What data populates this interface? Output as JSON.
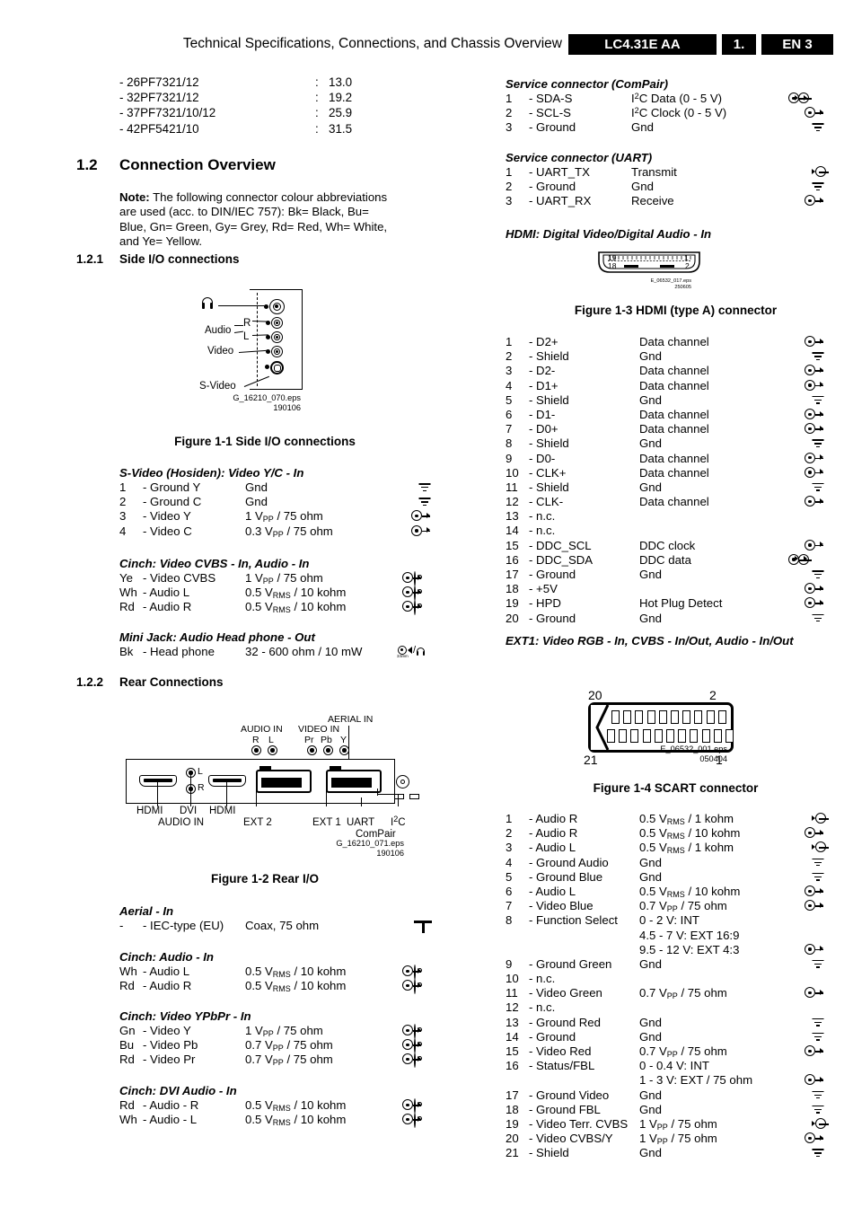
{
  "header": {
    "title": "Technical Specifications, Connections, and Chassis Overview",
    "chassis": "LC4.31E AA",
    "section": "1.",
    "page": "EN 3"
  },
  "models": [
    {
      "name": "- 26PF7321/12",
      "colon": ":",
      "value": "13.0"
    },
    {
      "name": "- 32PF7321/12",
      "colon": ":",
      "value": "19.2"
    },
    {
      "name": "- 37PF7321/10/12",
      "colon": ":",
      "value": "25.9"
    },
    {
      "name": "- 42PF5421/10",
      "colon": ":",
      "value": "31.5"
    }
  ],
  "section_12": {
    "number": "1.2",
    "title": "Connection Overview",
    "note_label": "Note:",
    "note_text": " The following connector colour abbreviations are used (acc. to DIN/IEC 757): Bk= Black, Bu= Blue, Gn= Green, Gy= Grey, Rd= Red, Wh= White, and Ye= Yellow."
  },
  "section_121": {
    "number": "1.2.1",
    "title": "Side I/O connections"
  },
  "section_122": {
    "number": "1.2.2",
    "title": "Rear Connections"
  },
  "figure_side_io": {
    "caption": "Figure 1-1 Side I/O connections",
    "eps": "G_16210_070.eps",
    "date": "190106",
    "labels": {
      "headphone": "headphone-icon",
      "audio": "Audio",
      "r": "R",
      "l": "L",
      "video": "Video",
      "svideo": "S-Video"
    }
  },
  "figure_rear_io": {
    "caption": "Figure 1-2 Rear I/O",
    "eps": "G_16210_071.eps",
    "date": "190106",
    "labels": {
      "audio_in": "AUDIO IN",
      "audio_r": "R",
      "audio_l": "L",
      "video_in": "VIDEO IN",
      "video_pr": "Pr",
      "video_pb": "Pb",
      "video_y": "Y",
      "aerial_in": "AERIAL IN",
      "hdmi1": "HDMI",
      "dvi": "DVI",
      "hdmi2": "HDMI",
      "dvi_audio_in": "AUDIO IN",
      "dvi_l": "L",
      "dvi_r": "R",
      "ext2": "EXT 2",
      "ext1": "EXT 1",
      "uart": "UART",
      "i2c_i": "I",
      "i2c_sup": "2",
      "i2c_c": "C",
      "compair": "ComPair"
    }
  },
  "figure_hdmi": {
    "caption": "Figure 1-3 HDMI (type A) connector",
    "eps": "E_06532_017.eps",
    "date": "250605",
    "pin_labels": {
      "p19": "19",
      "p18": "18",
      "p1": "1",
      "p2": "2"
    }
  },
  "figure_scart": {
    "caption": "Figure 1-4 SCART connector",
    "eps": "E_06532_001.eps",
    "date": "050404",
    "pin_labels": {
      "p20": "20",
      "p2": "2",
      "p21": "21",
      "p1": "1"
    }
  },
  "groups": {
    "svideo": {
      "title": "S-Video (Hosiden): Video Y/C - In",
      "rows": [
        {
          "pin": "1",
          "name": "- Ground Y",
          "value": "Gnd",
          "icon": "ground-icon"
        },
        {
          "pin": "2",
          "name": "- Ground C",
          "value": "Gnd",
          "icon": "ground-icon"
        },
        {
          "pin": "3",
          "name": "- Video Y",
          "value": "1 VPP / 75 ohm",
          "value_num": "1 V",
          "value_sub": "PP",
          "value_rest": " / 75 ohm",
          "icon": "input-icon"
        },
        {
          "pin": "4",
          "name": "- Video C",
          "value": "0.3 VPP / 75 ohm",
          "value_num": "0.3 V",
          "value_sub": "PP",
          "value_rest": " / 75 ohm",
          "icon": "input-icon"
        }
      ]
    },
    "cinch_cvbs": {
      "title": "Cinch: Video CVBS - In, Audio - In",
      "rows": [
        {
          "pin": "Ye",
          "name": "- Video CVBS",
          "value_num": "1 V",
          "value_sub": "PP",
          "value_rest": " / 75 ohm",
          "icon": "input-cinch-icon"
        },
        {
          "pin": "Wh",
          "name": "- Audio L",
          "value_num": "0.5 V",
          "value_sub": "RMS",
          "value_rest": " / 10 kohm",
          "icon": "input-cinch-icon"
        },
        {
          "pin": "Rd",
          "name": "- Audio R",
          "value_num": "0.5 V",
          "value_sub": "RMS",
          "value_rest": " / 10 kohm",
          "icon": "input-cinch-icon"
        }
      ]
    },
    "minijack": {
      "title": "Mini Jack: Audio Head phone - Out",
      "rows": [
        {
          "pin": "Bk",
          "name": "- Head phone",
          "value_num": "32 - 600 ohm / 10 mW",
          "value_sub": "",
          "value_rest": "",
          "icon": "headphone-jack-icon"
        }
      ]
    },
    "aerial": {
      "title": "Aerial - In",
      "rows": [
        {
          "pin": "-",
          "name": "- IEC-type (EU)",
          "value_num": "Coax, 75 ohm",
          "value_sub": "",
          "value_rest": "",
          "icon": "aerial-icon"
        }
      ]
    },
    "cinch_audio": {
      "title": "Cinch: Audio - In",
      "rows": [
        {
          "pin": "Wh",
          "name": "- Audio L",
          "value_num": "0.5 V",
          "value_sub": "RMS",
          "value_rest": " / 10 kohm",
          "icon": "input-cinch-icon"
        },
        {
          "pin": "Rd",
          "name": "- Audio R",
          "value_num": "0.5 V",
          "value_sub": "RMS",
          "value_rest": " / 10 kohm",
          "icon": "input-cinch-icon"
        }
      ]
    },
    "cinch_ypbpr": {
      "title": "Cinch: Video YPbPr - In",
      "rows": [
        {
          "pin": "Gn",
          "name": "- Video Y",
          "value_num": "1 V",
          "value_sub": "PP",
          "value_rest": " / 75 ohm",
          "icon": "input-cinch-icon"
        },
        {
          "pin": "Bu",
          "name": "- Video Pb",
          "value_num": "0.7 V",
          "value_sub": "PP",
          "value_rest": " / 75 ohm",
          "icon": "input-cinch-icon"
        },
        {
          "pin": "Rd",
          "name": "- Video Pr",
          "value_num": "0.7 V",
          "value_sub": "PP",
          "value_rest": " / 75 ohm",
          "icon": "input-cinch-icon"
        }
      ]
    },
    "cinch_dvi_audio": {
      "title": "Cinch: DVI Audio - In",
      "rows": [
        {
          "pin": "Rd",
          "name": "- Audio - R",
          "value_num": "0.5 V",
          "value_sub": "RMS",
          "value_rest": " / 10 kohm",
          "icon": "input-cinch-icon"
        },
        {
          "pin": "Wh",
          "name": "- Audio - L",
          "value_num": "0.5 V",
          "value_sub": "RMS",
          "value_rest": " / 10 kohm",
          "icon": "input-cinch-icon"
        }
      ]
    },
    "compair": {
      "title": "Service connector (ComPair)",
      "rows": [
        {
          "pin": "1",
          "name": "- SDA-S",
          "value_pre": "I",
          "value_sup": "2",
          "value_rest": "C Data (0 - 5 V)",
          "icon": "input-output-icon"
        },
        {
          "pin": "2",
          "name": "- SCL-S",
          "value_pre": "I",
          "value_sup": "2",
          "value_rest": "C Clock (0 - 5 V)",
          "icon": "input-icon"
        },
        {
          "pin": "3",
          "name": "- Ground",
          "value_pre": "Gnd",
          "value_sup": "",
          "value_rest": "",
          "icon": "ground-icon"
        }
      ]
    },
    "uart": {
      "title": "Service connector (UART)",
      "rows": [
        {
          "pin": "1",
          "name": "- UART_TX",
          "value_pre": "Transmit",
          "value_sup": "",
          "value_rest": "",
          "icon": "output-icon"
        },
        {
          "pin": "2",
          "name": "- Ground",
          "value_pre": "Gnd",
          "value_sup": "",
          "value_rest": "",
          "icon": "ground-icon"
        },
        {
          "pin": "3",
          "name": "- UART_RX",
          "value_pre": "Receive",
          "value_sup": "",
          "value_rest": "",
          "icon": "input-icon"
        }
      ]
    },
    "hdmi": {
      "title": "HDMI: Digital Video/Digital Audio - In",
      "rows": [
        {
          "pin": "1",
          "name": "- D2+",
          "value": "Data channel",
          "icon": "input-icon"
        },
        {
          "pin": "2",
          "name": "- Shield",
          "value": "Gnd",
          "icon": "ground-icon"
        },
        {
          "pin": "3",
          "name": "- D2-",
          "value": "Data channel",
          "icon": "input-icon"
        },
        {
          "pin": "4",
          "name": "- D1+",
          "value": "Data channel",
          "icon": "input-icon"
        },
        {
          "pin": "5",
          "name": "- Shield",
          "value": "Gnd",
          "icon": "ground-icon"
        },
        {
          "pin": "6",
          "name": "- D1-",
          "value": "Data channel",
          "icon": "input-icon"
        },
        {
          "pin": "7",
          "name": "- D0+",
          "value": "Data channel",
          "icon": "input-icon"
        },
        {
          "pin": "8",
          "name": "- Shield",
          "value": "Gnd",
          "icon": "ground-icon"
        },
        {
          "pin": "9",
          "name": "- D0-",
          "value": "Data channel",
          "icon": "input-icon"
        },
        {
          "pin": "10",
          "name": "- CLK+",
          "value": "Data channel",
          "icon": "input-icon"
        },
        {
          "pin": "11",
          "name": "- Shield",
          "value": "Gnd",
          "icon": "ground-icon"
        },
        {
          "pin": "12",
          "name": "- CLK-",
          "value": "Data channel",
          "icon": "input-icon"
        },
        {
          "pin": "13",
          "name": "- n.c.",
          "value": "",
          "icon": "none"
        },
        {
          "pin": "14",
          "name": "- n.c.",
          "value": "",
          "icon": "none"
        },
        {
          "pin": "15",
          "name": "- DDC_SCL",
          "value": "DDC clock",
          "icon": "input-icon"
        },
        {
          "pin": "16",
          "name": "- DDC_SDA",
          "value": "DDC data",
          "icon": "input-output-icon"
        },
        {
          "pin": "17",
          "name": "- Ground",
          "value": "Gnd",
          "icon": "ground-icon"
        },
        {
          "pin": "18",
          "name": "- +5V",
          "value": "",
          "icon": "input-icon"
        },
        {
          "pin": "19",
          "name": "- HPD",
          "value": "Hot Plug Detect",
          "icon": "input-icon"
        },
        {
          "pin": "20",
          "name": "- Ground",
          "value": "Gnd",
          "icon": "ground-icon"
        }
      ]
    },
    "ext1": {
      "title": "EXT1: Video RGB - In, CVBS - In/Out, Audio - In/Out",
      "rows": [
        {
          "pin": "1",
          "name": "- Audio R",
          "value_num": "0.5 V",
          "value_sub": "RMS",
          "value_rest": " / 1 kohm",
          "icon": "output-icon"
        },
        {
          "pin": "2",
          "name": "- Audio R",
          "value_num": "0.5 V",
          "value_sub": "RMS",
          "value_rest": " / 10 kohm",
          "icon": "input-icon"
        },
        {
          "pin": "3",
          "name": "- Audio L",
          "value_num": "0.5 V",
          "value_sub": "RMS",
          "value_rest": " / 1 kohm",
          "icon": "output-icon"
        },
        {
          "pin": "4",
          "name": "- Ground Audio",
          "value_num": "Gnd",
          "value_sub": "",
          "value_rest": "",
          "icon": "ground-icon"
        },
        {
          "pin": "5",
          "name": "- Ground Blue",
          "value_num": "Gnd",
          "value_sub": "",
          "value_rest": "",
          "icon": "ground-icon"
        },
        {
          "pin": "6",
          "name": "- Audio L",
          "value_num": "0.5 V",
          "value_sub": "RMS",
          "value_rest": " / 10 kohm",
          "icon": "input-icon"
        },
        {
          "pin": "7",
          "name": "- Video Blue",
          "value_num": "0.7 V",
          "value_sub": "PP",
          "value_rest": " / 75 ohm",
          "icon": "input-icon"
        },
        {
          "pin": "8",
          "name": "- Function Select",
          "value_num": "0 - 2 V: INT",
          "value_sub": "",
          "value_rest": "",
          "icon": "none",
          "extra_lines": [
            "4.5 - 7 V: EXT 16:9",
            "9.5 - 12 V: EXT 4:3"
          ],
          "extra_icon": "input-icon"
        },
        {
          "pin": "9",
          "name": "- Ground Green",
          "value_num": "Gnd",
          "value_sub": "",
          "value_rest": "",
          "icon": "ground-icon"
        },
        {
          "pin": "10",
          "name": "- n.c.",
          "value_num": "",
          "value_sub": "",
          "value_rest": "",
          "icon": "none"
        },
        {
          "pin": "11",
          "name": "- Video Green",
          "value_num": "0.7 V",
          "value_sub": "PP",
          "value_rest": " / 75 ohm",
          "icon": "input-icon"
        },
        {
          "pin": "12",
          "name": "- n.c.",
          "value_num": "",
          "value_sub": "",
          "value_rest": "",
          "icon": "none"
        },
        {
          "pin": "13",
          "name": "- Ground Red",
          "value_num": "Gnd",
          "value_sub": "",
          "value_rest": "",
          "icon": "ground-icon"
        },
        {
          "pin": "14",
          "name": "- Ground",
          "value_num": "Gnd",
          "value_sub": "",
          "value_rest": "",
          "icon": "ground-icon"
        },
        {
          "pin": "15",
          "name": "- Video Red",
          "value_num": "0.7 V",
          "value_sub": "PP",
          "value_rest": " / 75 ohm",
          "icon": "input-icon"
        },
        {
          "pin": "16",
          "name": "- Status/FBL",
          "value_num": "0 - 0.4 V: INT",
          "value_sub": "",
          "value_rest": "",
          "icon": "none",
          "extra_lines": [
            "1 - 3 V: EXT / 75 ohm"
          ],
          "extra_icon": "input-icon"
        },
        {
          "pin": "17",
          "name": "- Ground Video",
          "value_num": "Gnd",
          "value_sub": "",
          "value_rest": "",
          "icon": "ground-icon"
        },
        {
          "pin": "18",
          "name": "- Ground FBL",
          "value_num": "Gnd",
          "value_sub": "",
          "value_rest": "",
          "icon": "ground-icon"
        },
        {
          "pin": "19",
          "name": "- Video Terr. CVBS",
          "value_num": "1 V",
          "value_sub": "PP",
          "value_rest": " / 75 ohm",
          "icon": "output-icon"
        },
        {
          "pin": "20",
          "name": "- Video CVBS/Y",
          "value_num": "1 V",
          "value_sub": "PP",
          "value_rest": " / 75 ohm",
          "icon": "input-icon"
        },
        {
          "pin": "21",
          "name": "- Shield",
          "value_num": "Gnd",
          "value_sub": "",
          "value_rest": "",
          "icon": "ground-icon"
        }
      ]
    }
  }
}
